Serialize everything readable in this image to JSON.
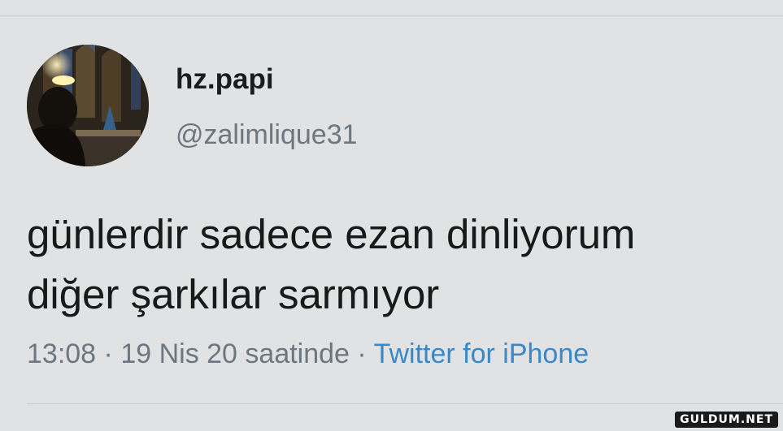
{
  "tweet": {
    "display_name": "hz.papi",
    "handle": "@zalimlique31",
    "text_lines": [
      "günlerdir sadece ezan dinliyorum",
      "diğer şarkılar sarmıyor"
    ],
    "time": "13:08",
    "separator": "·",
    "date": "19 Nis 20 saatinde",
    "source": "Twitter for iPhone"
  },
  "watermark": "GULDUM.NET",
  "colors": {
    "background": "#e1e2e3",
    "text": "#181919",
    "secondary_text": "#6d7781",
    "link": "#3b88c8"
  },
  "icons": {
    "avatar": "profile-photo"
  }
}
